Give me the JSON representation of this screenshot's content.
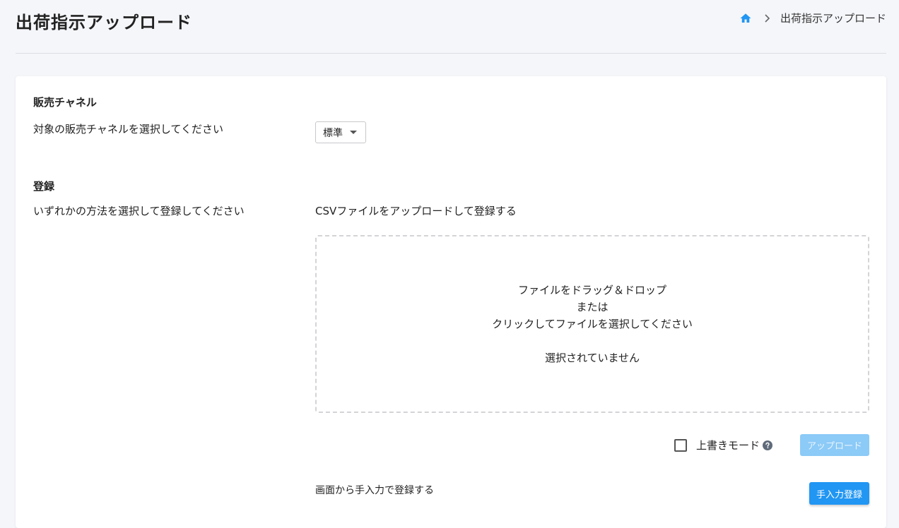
{
  "header": {
    "title": "出荷指示アップロード",
    "breadcrumb": {
      "home_icon": "home-icon",
      "separator_icon": "chevron-right-icon",
      "current": "出荷指示アップロード"
    }
  },
  "channel_section": {
    "title": "販売チャネル",
    "label": "対象の販売チャネルを選択してください",
    "select": {
      "value": "標準"
    }
  },
  "register_section": {
    "title": "登録",
    "label": "いずれかの方法を選択して登録してください",
    "csv_heading": "CSVファイルをアップロードして登録する",
    "dropzone": {
      "line1": "ファイルをドラッグ＆ドロップ",
      "line2": "または",
      "line3": "クリックしてファイルを選択してください",
      "status": "選択されていません"
    },
    "overwrite_label": "上書きモード",
    "upload_button": "アップロード",
    "manual_heading": "画面から手入力で登録する",
    "manual_button": "手入力登録"
  },
  "colors": {
    "accent": "#2196f3",
    "accent_disabled": "#8ccaf7",
    "background": "#f5f6fa"
  }
}
